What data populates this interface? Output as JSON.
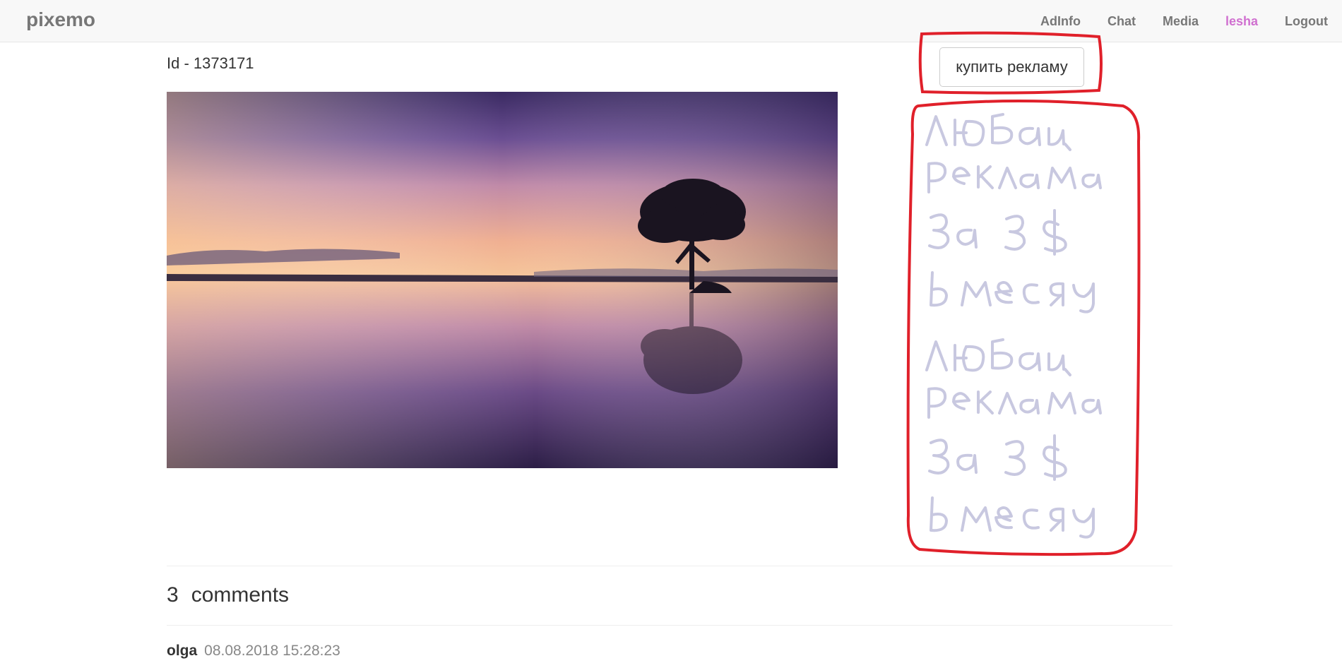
{
  "navbar": {
    "brand": "pixemo",
    "links": [
      {
        "label": "AdInfo"
      },
      {
        "label": "Chat"
      },
      {
        "label": "Media"
      },
      {
        "label": "lesha"
      },
      {
        "label": "Logout"
      }
    ]
  },
  "post": {
    "id_label": "Id - 1373171"
  },
  "ad": {
    "buy_button_label": "купить рекламу",
    "handwritten_note": "любая реклама за 3$ в месяц любая реклама за 3$ в месяц"
  },
  "comments": {
    "count": "3",
    "label": "comments",
    "items": [
      {
        "author": "olga",
        "date": "08.08.2018 15:28:23"
      }
    ]
  },
  "colors": {
    "active_user_link": "#d070d0",
    "annotation_red": "#e0202a",
    "handwriting": "#c8c8e0"
  }
}
